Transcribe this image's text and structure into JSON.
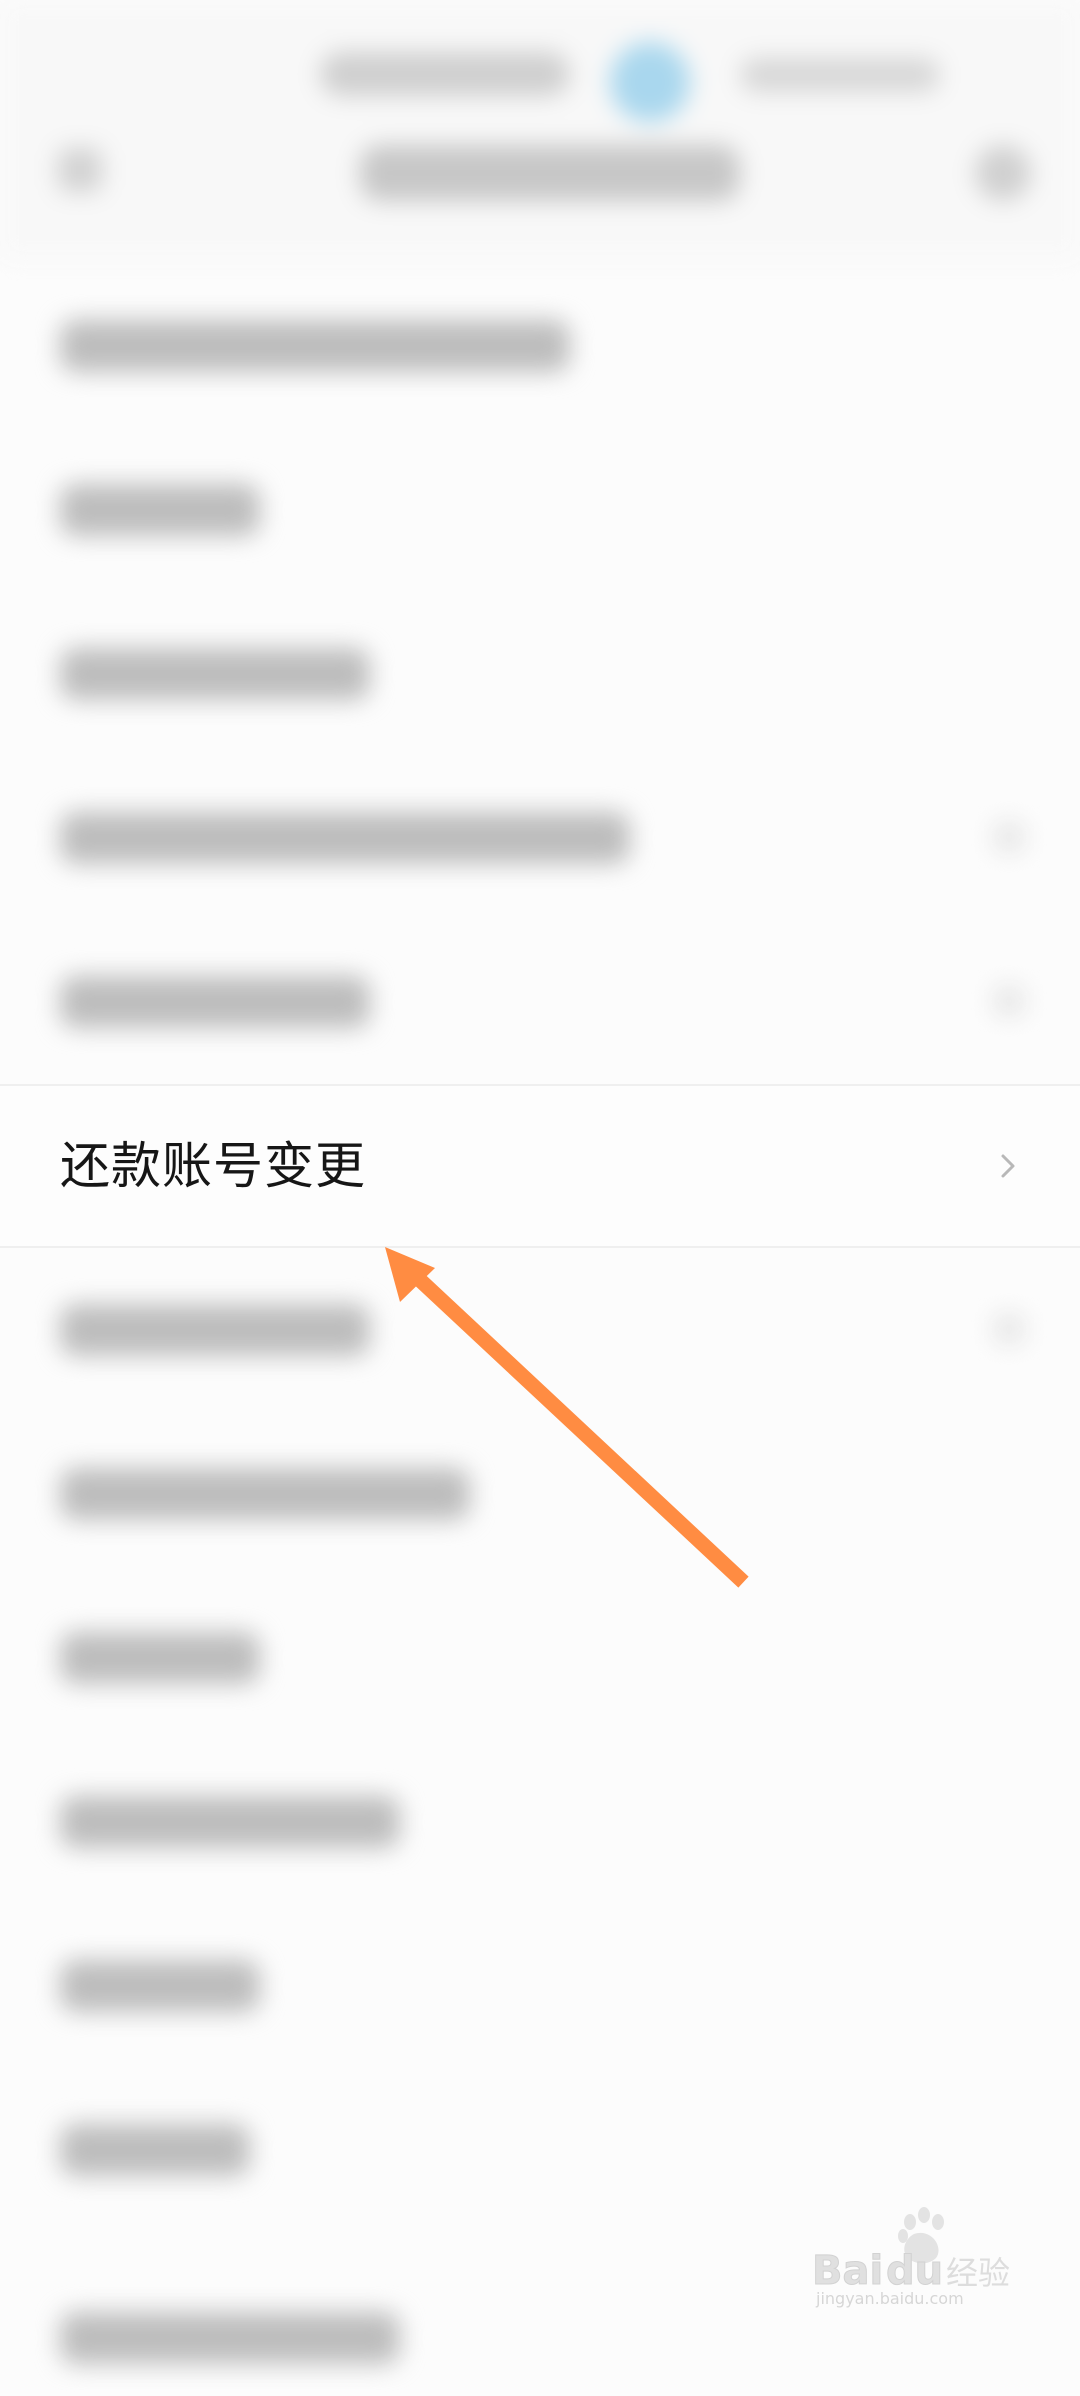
{
  "list": {
    "highlighted_item": {
      "label": "还款账号变更"
    }
  },
  "annotation": {
    "arrow_color": "#ff8c42"
  },
  "watermark": {
    "brand": "Baidu",
    "brand_suffix": "经验",
    "url": "jingyan.baidu.com"
  }
}
